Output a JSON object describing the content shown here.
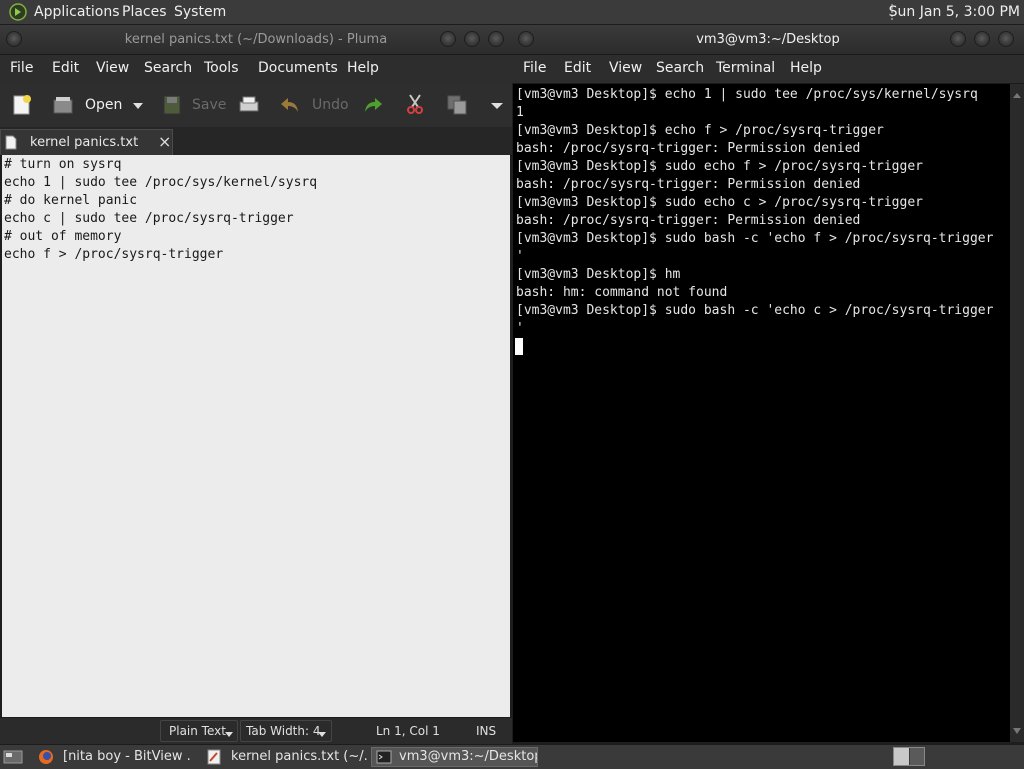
{
  "top_panel": {
    "menus": [
      "Applications",
      "Places",
      "System"
    ],
    "clock": "Sun Jan  5,  3:00 PM"
  },
  "editor": {
    "title": "kernel panics.txt (~/Downloads) - Pluma",
    "menu": [
      "File",
      "Edit",
      "View",
      "Search",
      "Tools",
      "Documents",
      "Help"
    ],
    "toolbar": {
      "open": "Open",
      "save": "Save",
      "undo": "Undo"
    },
    "tab": {
      "label": "kernel panics.txt",
      "close": "×"
    },
    "lines": [
      "# turn on sysrq",
      "echo 1 | sudo tee /proc/sys/kernel/sysrq",
      "# do kernel panic",
      "echo c | sudo tee /proc/sysrq-trigger",
      "# out of memory",
      "echo f > /proc/sysrq-trigger"
    ],
    "status": {
      "language": "Plain Text",
      "tab_width": "Tab Width:  4",
      "position": "Ln 1, Col 1",
      "mode": "INS"
    }
  },
  "terminal": {
    "title": "vm3@vm3:~/Desktop",
    "menu": [
      "File",
      "Edit",
      "View",
      "Search",
      "Terminal",
      "Help"
    ],
    "lines": [
      "[vm3@vm3 Desktop]$ echo 1 | sudo tee /proc/sys/kernel/sysrq",
      "1",
      "[vm3@vm3 Desktop]$ echo f > /proc/sysrq-trigger",
      "bash: /proc/sysrq-trigger: Permission denied",
      "[vm3@vm3 Desktop]$ sudo echo f > /proc/sysrq-trigger",
      "bash: /proc/sysrq-trigger: Permission denied",
      "[vm3@vm3 Desktop]$ sudo echo c > /proc/sysrq-trigger",
      "bash: /proc/sysrq-trigger: Permission denied",
      "[vm3@vm3 Desktop]$ sudo bash -c 'echo f > /proc/sysrq-trigger",
      "'",
      "[vm3@vm3 Desktop]$ hm",
      "bash: hm: command not found",
      "[vm3@vm3 Desktop]$ sudo bash -c 'echo c > /proc/sysrq-trigger",
      "'"
    ]
  },
  "taskbar": {
    "items": [
      {
        "label": "[nita boy - BitView ...",
        "icon": "firefox-icon"
      },
      {
        "label": "kernel panics.txt (~/...",
        "icon": "text-editor-icon"
      },
      {
        "label": "vm3@vm3:~/Desktop",
        "icon": "terminal-icon",
        "active": true
      }
    ]
  }
}
